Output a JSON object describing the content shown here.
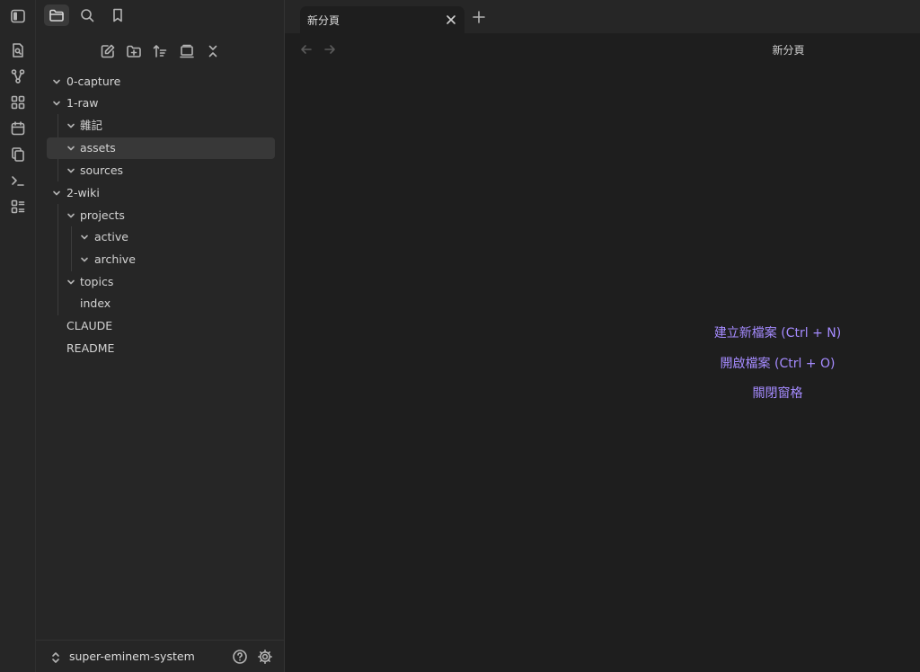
{
  "sidebar": {
    "tree": [
      {
        "label": "0-capture",
        "type": "folder"
      },
      {
        "label": "1-raw",
        "type": "folder"
      },
      {
        "label": "雜記",
        "type": "folder"
      },
      {
        "label": "assets",
        "type": "folder",
        "selected": true
      },
      {
        "label": "sources",
        "type": "folder"
      },
      {
        "label": "2-wiki",
        "type": "folder"
      },
      {
        "label": "projects",
        "type": "folder"
      },
      {
        "label": "active",
        "type": "folder"
      },
      {
        "label": "archive",
        "type": "folder"
      },
      {
        "label": "topics",
        "type": "folder"
      },
      {
        "label": "index",
        "type": "file"
      },
      {
        "label": "CLAUDE",
        "type": "file"
      },
      {
        "label": "README",
        "type": "file"
      }
    ],
    "vault_name": "super-eminem-system"
  },
  "tabs": [
    {
      "title": "新分頁",
      "active": true
    }
  ],
  "content": {
    "header_title": "新分頁",
    "actions": {
      "new_file": "建立新檔案 (Ctrl + N)",
      "open_file": "開啟檔案 (Ctrl + O)",
      "close_pane": "關閉窗格"
    }
  },
  "colors": {
    "background": "#1e1e1e",
    "sidebar": "#262626",
    "accent": "#a58bff",
    "selected_row": "#383838"
  }
}
